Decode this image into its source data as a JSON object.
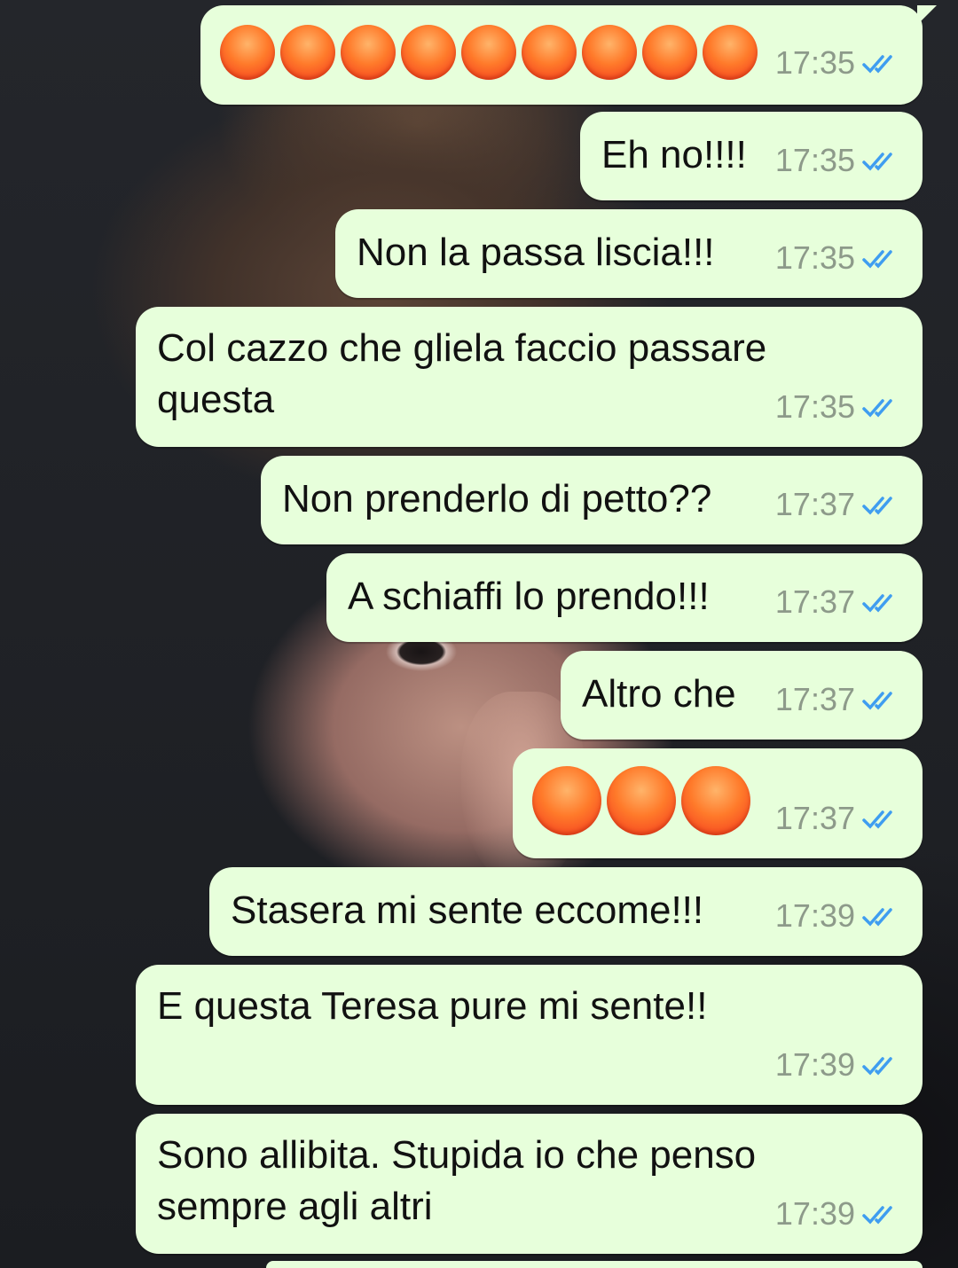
{
  "messages": [
    {
      "type": "emoji",
      "emoji_icon": "angry-face-icon",
      "emoji_count": 9,
      "time": "17:35",
      "status": "read"
    },
    {
      "type": "text",
      "text": "Eh no!!!!",
      "time": "17:35",
      "status": "read"
    },
    {
      "type": "text",
      "text": "Non la passa liscia!!!",
      "time": "17:35",
      "status": "read"
    },
    {
      "type": "text",
      "text": "Col cazzo che gliela faccio passare\nquesta",
      "time": "17:35",
      "status": "read"
    },
    {
      "type": "text",
      "text": "Non prenderlo di petto??",
      "time": "17:37",
      "status": "read"
    },
    {
      "type": "text",
      "text": "A schiaffi lo prendo!!!",
      "time": "17:37",
      "status": "read"
    },
    {
      "type": "text",
      "text": "Altro che",
      "time": "17:37",
      "status": "read"
    },
    {
      "type": "emoji",
      "emoji_icon": "angry-face-icon",
      "emoji_count": 3,
      "time": "17:37",
      "status": "read"
    },
    {
      "type": "text",
      "text": "Stasera mi sente eccome!!!",
      "time": "17:39",
      "status": "read"
    },
    {
      "type": "text",
      "text": "E questa Teresa pure mi sente!!",
      "time": "17:39",
      "status": "read"
    },
    {
      "type": "text",
      "text": "Sono allibita. Stupida io che penso\nsempre agli altri",
      "time": "17:39",
      "status": "read"
    }
  ],
  "colors": {
    "outgoing_bubble": "#e7ffdb",
    "timestamp": "#8d9a8a",
    "read_ticks": "#3f9df0",
    "text": "#111111"
  }
}
